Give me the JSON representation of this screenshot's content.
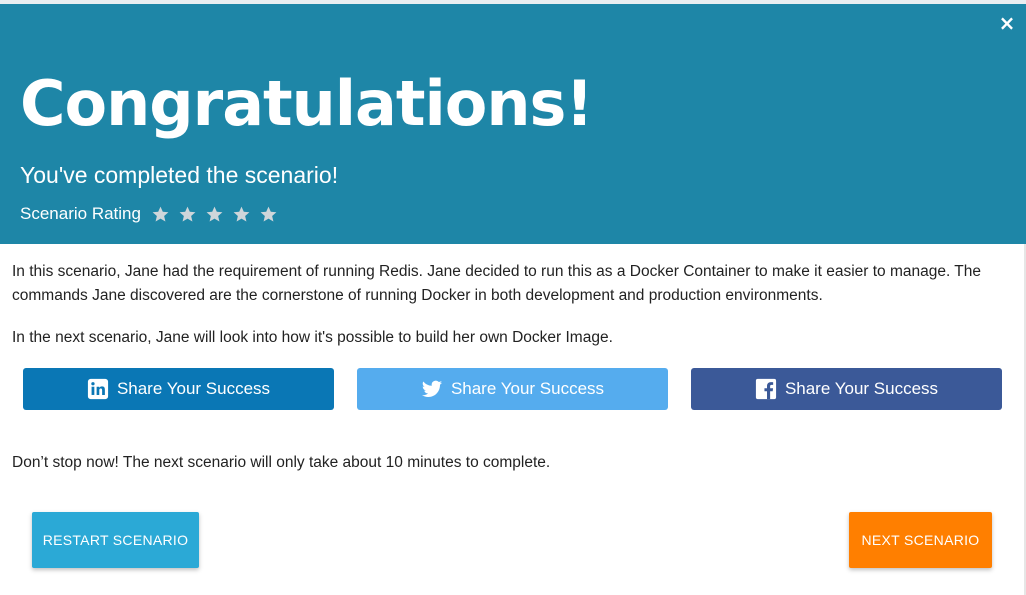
{
  "header": {
    "title": "Congratulations!",
    "subtitle": "You've completed the scenario!",
    "rating_label": "Scenario Rating",
    "stars": 5,
    "close_icon": "×"
  },
  "body": {
    "paragraph1": "In this scenario, Jane had the requirement of running Redis. Jane decided to run this as a Docker Container to make it easier to manage. The commands Jane discovered are the cornerstone of running Docker in both development and production environments.",
    "paragraph2": "In the next scenario, Jane will look into how it's possible to build her own Docker Image.",
    "paragraph3": "Don’t stop now! The next scenario will only take about 10 minutes to complete."
  },
  "share": {
    "linkedin_label": "Share Your Success",
    "twitter_label": "Share Your Success",
    "facebook_label": "Share Your Success"
  },
  "actions": {
    "restart_label": "RESTART SCENARIO",
    "next_label": "NEXT SCENARIO"
  },
  "colors": {
    "header_bg": "#1e86a7",
    "linkedin": "#0a77b5",
    "twitter": "#55acee",
    "facebook": "#3b5998",
    "restart": "#2ba9d6",
    "next": "#ff7f00"
  }
}
